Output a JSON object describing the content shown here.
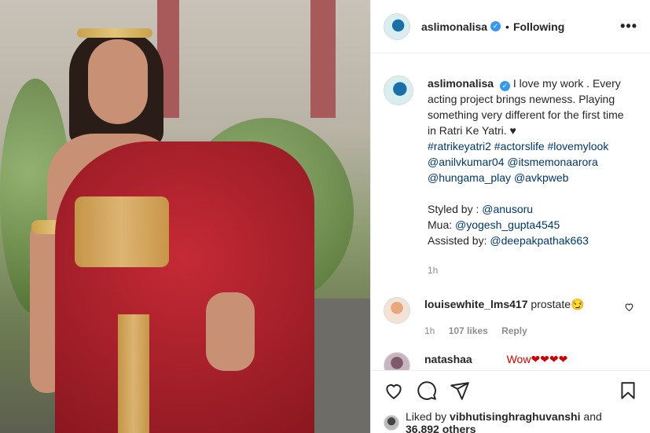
{
  "post": {
    "username": "aslimonalisa",
    "follow_status": "Following",
    "more_label": "•••"
  },
  "caption": {
    "username": "aslimonalisa",
    "text": "I love my work . Every acting project brings newness. Playing something very different for the first time in Ratri Ke Yatri. ♥",
    "tags_line1": "#ratrikeyatri2 #actorslife #lovemylook",
    "tags_line2": "@anilvkumar04 @itsmemonaarora",
    "tags_line3": "@hungama_play @avkpweb",
    "styled_label": "Styled by : ",
    "styled_user": "@anusoru",
    "mua_label": "Mua: ",
    "mua_user": "@yogesh_gupta4545",
    "assisted_label": "Assisted by: ",
    "assisted_user": "@deepakpathak663",
    "time": "1h"
  },
  "comments": [
    {
      "username": "louisewhite_lms417",
      "text": "prostate😏",
      "time": "1h",
      "likes": "107 likes",
      "reply": "Reply"
    },
    {
      "username": "natashaa",
      "text": "Wow❤❤❤❤"
    }
  ],
  "likes": {
    "prefix": "Liked by ",
    "user": "vibhutisinghraghuvanshi",
    "suffix": " and",
    "others": "36,892 others"
  },
  "icons": [
    "heart-icon",
    "comment-icon",
    "share-icon",
    "bookmark-icon"
  ],
  "colors": {
    "verified": "#3897f0",
    "link": "#00376b",
    "muted": "#8e8e8e"
  }
}
